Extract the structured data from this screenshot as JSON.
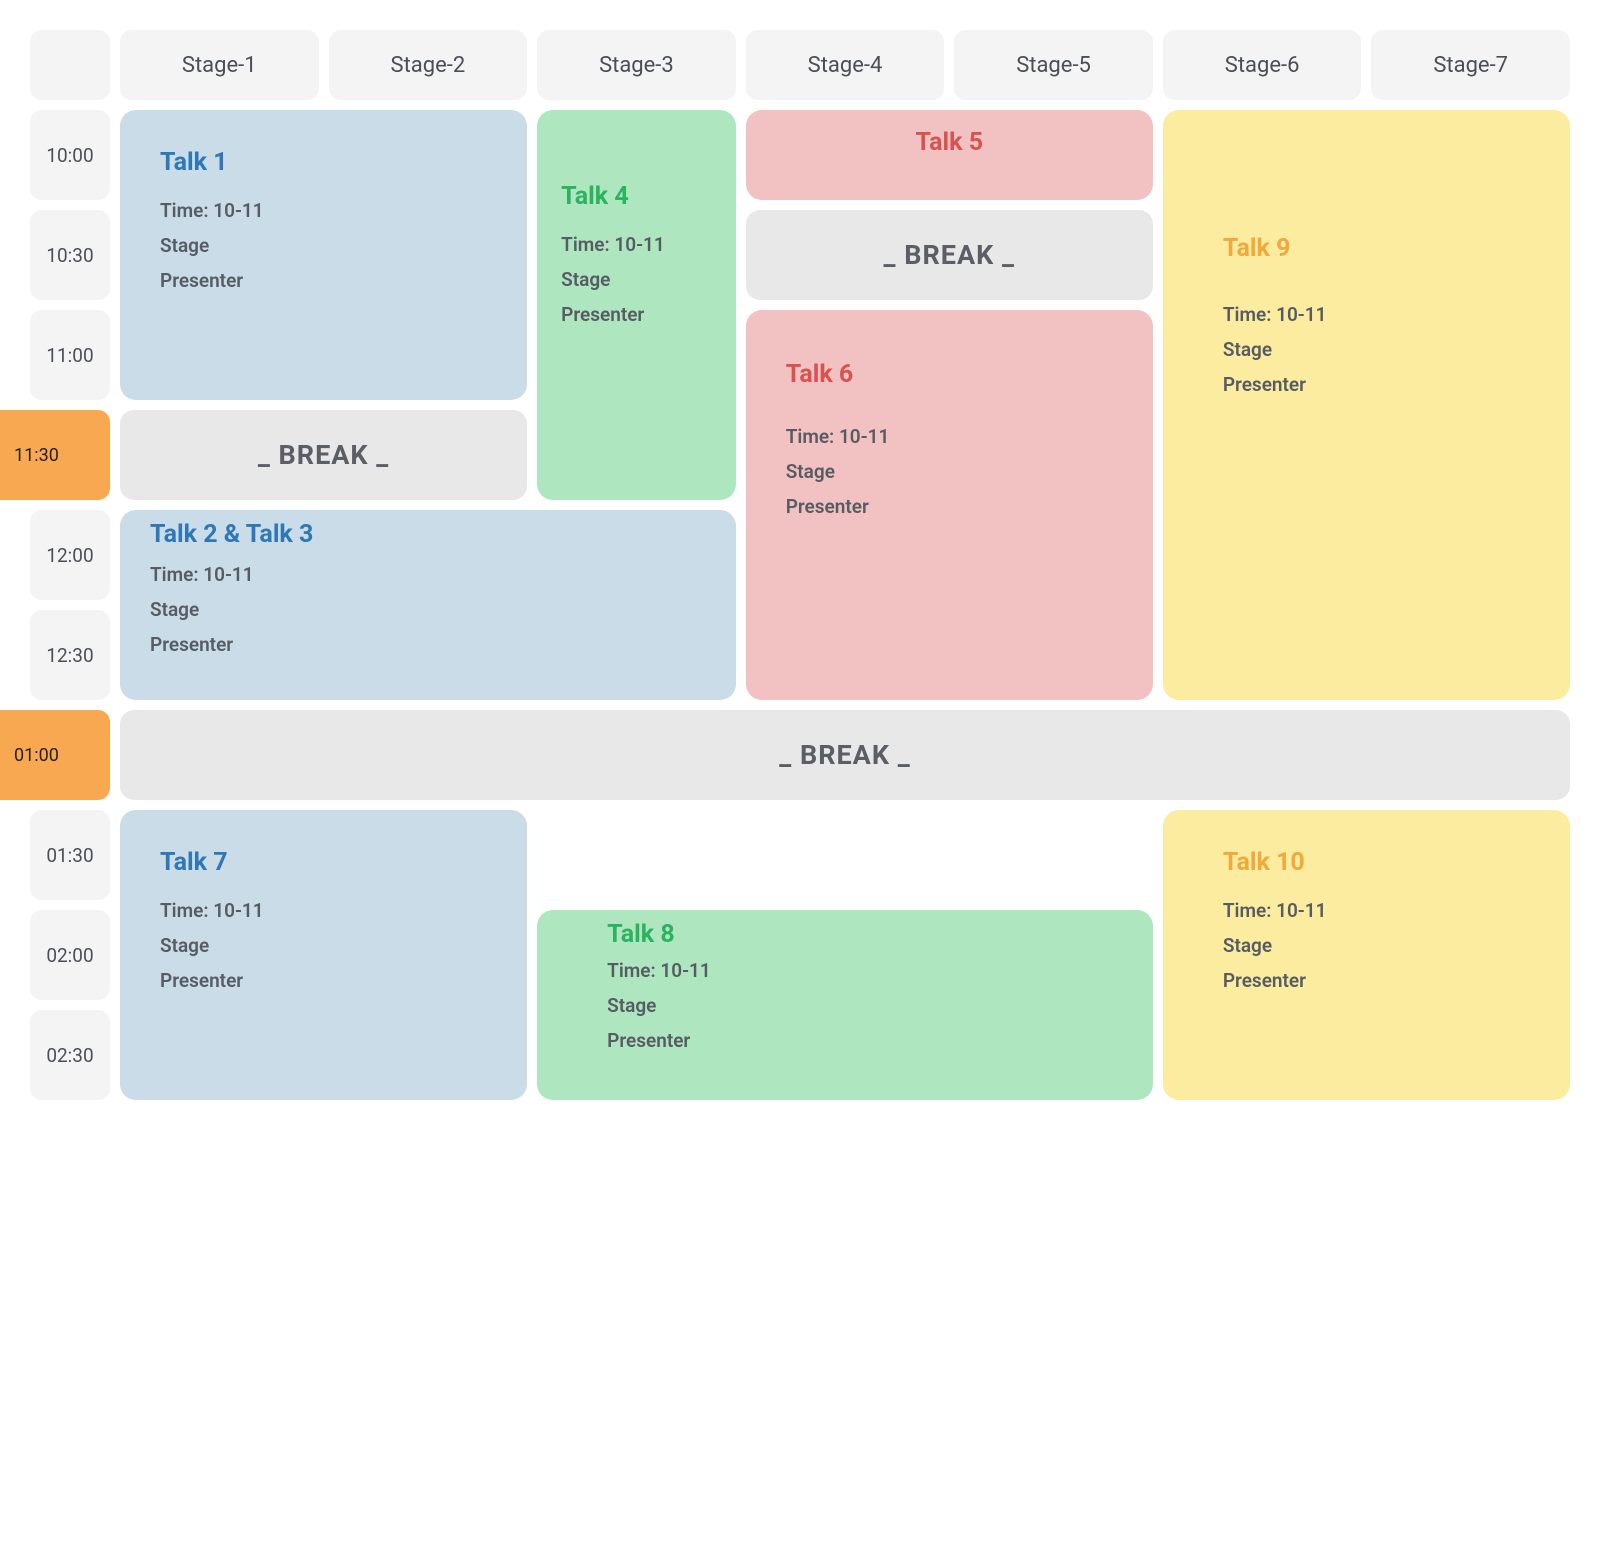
{
  "stages": [
    "Stage-1",
    "Stage-2",
    "Stage-3",
    "Stage-4",
    "Stage-5",
    "Stage-6",
    "Stage-7"
  ],
  "times": [
    "10:00",
    "10:30",
    "11:00",
    "11:30",
    "12:00",
    "12:30",
    "01:00",
    "01:30",
    "02:00",
    "02:30"
  ],
  "time_highlight": {
    "11:30": true,
    "01:00": true
  },
  "break_label": "_ BREAK _",
  "detail": {
    "time": "Time: 10-11",
    "stage": "Stage",
    "presenter": "Presenter"
  },
  "talks": {
    "t1": {
      "title": "Talk 1"
    },
    "t23": {
      "title": "Talk 2 & Talk 3"
    },
    "t4": {
      "title": "Talk 4"
    },
    "t5": {
      "title": "Talk 5"
    },
    "t6": {
      "title": "Talk 6"
    },
    "t7": {
      "title": "Talk 7"
    },
    "t8": {
      "title": "Talk 8"
    },
    "t9": {
      "title": "Talk 9"
    },
    "t10": {
      "title": "Talk 10"
    }
  }
}
